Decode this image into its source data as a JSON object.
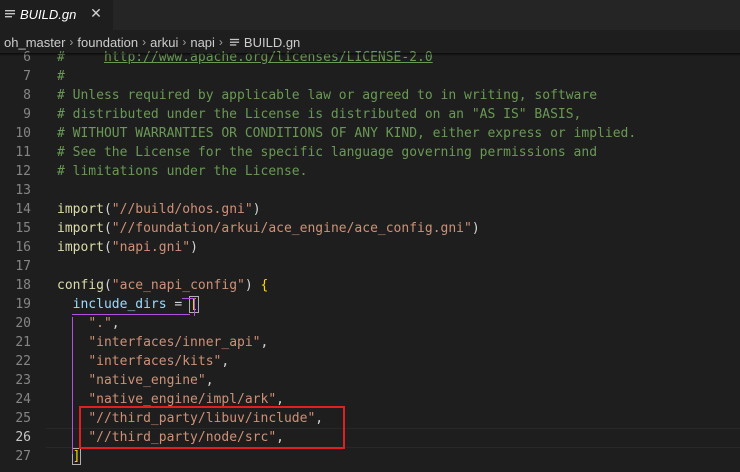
{
  "tab": {
    "filename": "BUILD.gn",
    "close_glyph": "✕"
  },
  "breadcrumbs": [
    "oh_master",
    "foundation",
    "arkui",
    "napi",
    "BUILD.gn"
  ],
  "colors": {
    "background": "#1e1e1e",
    "comment": "#6a9955",
    "string": "#ce9178",
    "function": "#dcdcaa",
    "variable": "#9cdcfe",
    "brace": "#ffd700",
    "highlight_box": "#e02020",
    "indent_box": "#b450e0"
  },
  "editor": {
    "active_line": "26",
    "lines": [
      {
        "n": "6",
        "parts": [
          {
            "t": "#     ",
            "c": "comment"
          },
          {
            "t": "http://www.apache.org/licenses/LICENSE-2.0",
            "c": "comment link"
          }
        ]
      },
      {
        "n": "7",
        "parts": [
          {
            "t": "#",
            "c": "comment"
          }
        ]
      },
      {
        "n": "8",
        "parts": [
          {
            "t": "# Unless required by applicable law or agreed to in writing, software",
            "c": "comment"
          }
        ]
      },
      {
        "n": "9",
        "parts": [
          {
            "t": "# distributed under the License is distributed on an \"AS IS\" BASIS,",
            "c": "comment"
          }
        ]
      },
      {
        "n": "10",
        "parts": [
          {
            "t": "# WITHOUT WARRANTIES OR CONDITIONS OF ANY KIND, either express or implied.",
            "c": "comment"
          }
        ]
      },
      {
        "n": "11",
        "parts": [
          {
            "t": "# See the License for the specific language governing permissions and",
            "c": "comment"
          }
        ]
      },
      {
        "n": "12",
        "parts": [
          {
            "t": "# limitations under the License.",
            "c": "comment"
          }
        ]
      },
      {
        "n": "13",
        "parts": []
      },
      {
        "n": "14",
        "parts": [
          {
            "t": "import",
            "c": "fn"
          },
          {
            "t": "(",
            "c": "punc"
          },
          {
            "t": "\"//build/ohos.gni\"",
            "c": "str"
          },
          {
            "t": ")",
            "c": "punc"
          }
        ]
      },
      {
        "n": "15",
        "parts": [
          {
            "t": "import",
            "c": "fn"
          },
          {
            "t": "(",
            "c": "punc"
          },
          {
            "t": "\"//foundation/arkui/ace_engine/ace_config.gni\"",
            "c": "str"
          },
          {
            "t": ")",
            "c": "punc"
          }
        ]
      },
      {
        "n": "16",
        "parts": [
          {
            "t": "import",
            "c": "fn"
          },
          {
            "t": "(",
            "c": "punc"
          },
          {
            "t": "\"napi.gni\"",
            "c": "str"
          },
          {
            "t": ")",
            "c": "punc"
          }
        ]
      },
      {
        "n": "17",
        "parts": []
      },
      {
        "n": "18",
        "parts": [
          {
            "t": "config",
            "c": "fn"
          },
          {
            "t": "(",
            "c": "punc"
          },
          {
            "t": "\"ace_napi_config\"",
            "c": "str"
          },
          {
            "t": ") ",
            "c": "punc"
          },
          {
            "t": "{",
            "c": "brace"
          }
        ]
      },
      {
        "n": "19",
        "parts": [
          {
            "t": "  ",
            "c": "punc"
          },
          {
            "t": "include_dirs",
            "c": "var"
          },
          {
            "t": " = ",
            "c": "punc"
          },
          {
            "t": "[",
            "c": "brace bracket-match"
          }
        ]
      },
      {
        "n": "20",
        "parts": [
          {
            "t": "    ",
            "c": "punc"
          },
          {
            "t": "\".\"",
            "c": "str"
          },
          {
            "t": ",",
            "c": "punc"
          }
        ]
      },
      {
        "n": "21",
        "parts": [
          {
            "t": "    ",
            "c": "punc"
          },
          {
            "t": "\"interfaces/inner_api\"",
            "c": "str"
          },
          {
            "t": ",",
            "c": "punc"
          }
        ]
      },
      {
        "n": "22",
        "parts": [
          {
            "t": "    ",
            "c": "punc"
          },
          {
            "t": "\"interfaces/kits\"",
            "c": "str"
          },
          {
            "t": ",",
            "c": "punc"
          }
        ]
      },
      {
        "n": "23",
        "parts": [
          {
            "t": "    ",
            "c": "punc"
          },
          {
            "t": "\"native_engine\"",
            "c": "str"
          },
          {
            "t": ",",
            "c": "punc"
          }
        ]
      },
      {
        "n": "24",
        "parts": [
          {
            "t": "    ",
            "c": "punc"
          },
          {
            "t": "\"native_engine/impl/ark\"",
            "c": "str"
          },
          {
            "t": ",",
            "c": "punc"
          }
        ]
      },
      {
        "n": "25",
        "parts": [
          {
            "t": "    ",
            "c": "punc"
          },
          {
            "t": "\"//third_party/libuv/include\"",
            "c": "str"
          },
          {
            "t": ",",
            "c": "punc"
          }
        ]
      },
      {
        "n": "26",
        "parts": [
          {
            "t": "    ",
            "c": "punc"
          },
          {
            "t": "\"//third_party/node/src\"",
            "c": "str"
          },
          {
            "t": ",",
            "c": "punc"
          }
        ]
      },
      {
        "n": "27",
        "parts": [
          {
            "t": "  ",
            "c": "punc"
          },
          {
            "t": "]",
            "c": "brace bracket-match"
          }
        ]
      }
    ]
  }
}
